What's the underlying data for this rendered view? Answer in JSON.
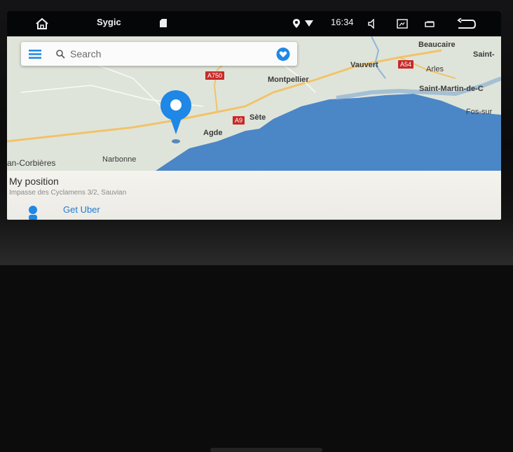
{
  "status_bar": {
    "app_name": "Sygic",
    "time": "16:34",
    "icons": [
      "home-icon",
      "sd-card-icon",
      "location-icon",
      "wifi-icon",
      "volume-icon",
      "screenshot-icon",
      "recent-apps-icon",
      "back-icon"
    ]
  },
  "search": {
    "placeholder": "Search",
    "icons": [
      "menu-icon",
      "search-icon",
      "favorite-heart-icon"
    ]
  },
  "map": {
    "labels": {
      "beaucaire": "Beaucaire",
      "saint": "Saint-",
      "vauvert": "Vauvert",
      "arles": "Arles",
      "montpellier": "Montpellier",
      "saint_martin": "Saint-Martin-de-C",
      "sete": "Sète",
      "fos": "Fos-sur",
      "agde": "Agde",
      "narbonne": "Narbonne",
      "corbieres": "an-Corbières"
    },
    "road_shields": {
      "a750": "A750",
      "a54": "A54",
      "a9": "A9"
    },
    "colors": {
      "sea": "#4b86c6",
      "land": "#dfe4da",
      "road": "#f0c36a",
      "marker": "#1f87e5",
      "shield": "#c72a28"
    }
  },
  "panel": {
    "title": "My position",
    "address": "Impasse des Cyclamens 3/2, Sauvian",
    "action": "Get Uber"
  }
}
